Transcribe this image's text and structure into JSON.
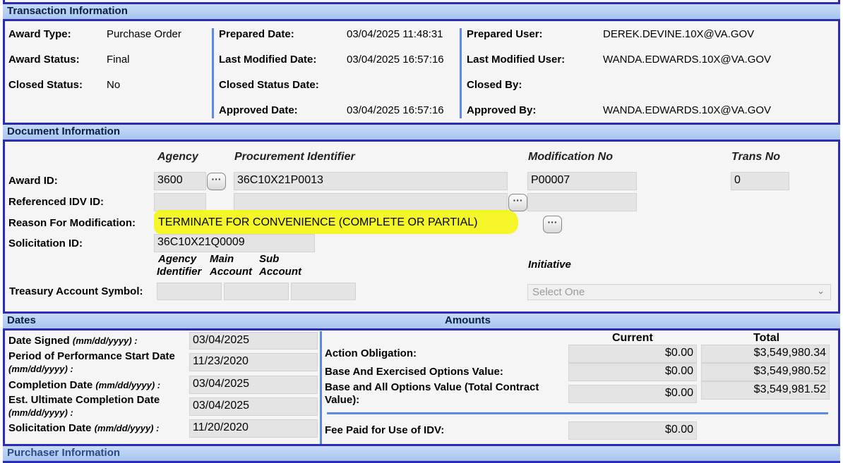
{
  "transaction": {
    "title": "Transaction Information",
    "award_type_label": "Award Type:",
    "award_type": "Purchase Order",
    "award_status_label": "Award Status:",
    "award_status": "Final",
    "closed_status_label": "Closed Status:",
    "closed_status": "No",
    "prepared_date_label": "Prepared Date:",
    "prepared_date": "03/04/2025 11:48:31",
    "last_modified_date_label": "Last Modified Date:",
    "last_modified_date": "03/04/2025 16:57:16",
    "closed_status_date_label": "Closed Status Date:",
    "approved_date_label": "Approved Date:",
    "approved_date": "03/04/2025 16:57:16",
    "prepared_user_label": "Prepared User:",
    "prepared_user": "DEREK.DEVINE.10X@VA.GOV",
    "last_modified_user_label": "Last Modified User:",
    "last_modified_user": "WANDA.EDWARDS.10X@VA.GOV",
    "closed_by_label": "Closed By:",
    "approved_by_label": "Approved By:",
    "approved_by": "WANDA.EDWARDS.10X@VA.GOV"
  },
  "document": {
    "title": "Document Information",
    "col_agency": "Agency",
    "col_procurement": "Procurement Identifier",
    "col_modification": "Modification No",
    "col_trans": "Trans No",
    "award_id_label": "Award ID:",
    "award_agency": "3600",
    "award_procurement": "36C10X21P0013",
    "award_modification": "P00007",
    "award_trans": "0",
    "ref_idv_label": "Referenced IDV ID:",
    "reason_label": "Reason For Modification:",
    "reason_value": "TERMINATE FOR CONVENIENCE (COMPLETE OR PARTIAL)",
    "solicitation_label": "Solicitation ID:",
    "solicitation_value": "36C10X21Q0009",
    "tas_col_agency_1": "Agency",
    "tas_col_agency_2": "Identifier",
    "tas_col_main_1": "Main",
    "tas_col_main_2": "Account",
    "tas_col_sub_1": "Sub",
    "tas_col_sub_2": "Account",
    "initiative_label": "Initiative",
    "tas_label": "Treasury Account Symbol:",
    "initiative_placeholder": "Select One",
    "ellipsis": "···"
  },
  "dates": {
    "title": "Dates",
    "date_signed_label": "Date Signed",
    "date_signed_fmt": "(mm/dd/yyyy) :",
    "date_signed": "03/04/2025",
    "pop_start_label": "Period of Performance Start Date",
    "pop_start_fmt": "(mm/dd/yyyy) :",
    "pop_start": "11/23/2020",
    "completion_label": "Completion Date",
    "completion_fmt": "(mm/dd/yyyy) :",
    "completion": "03/04/2025",
    "est_completion_label": "Est. Ultimate Completion Date",
    "est_completion_fmt": "(mm/dd/yyyy) :",
    "est_completion": "03/04/2025",
    "solicitation_date_label": "Solicitation Date",
    "solicitation_date_fmt": "(mm/dd/yyyy) :",
    "solicitation_date": "11/20/2020"
  },
  "amounts": {
    "title": "Amounts",
    "col_current": "Current",
    "col_total": "Total",
    "action_obligation_label": "Action Obligation:",
    "action_obligation_current": "$0.00",
    "action_obligation_total": "$3,549,980.34",
    "base_exercised_label": "Base And Exercised Options Value:",
    "base_exercised_current": "$0.00",
    "base_exercised_total": "$3,549,980.52",
    "base_all_label_1": "Base and All Options Value (Total Contract",
    "base_all_label_2": "Value):",
    "base_all_current": "$0.00",
    "base_all_total": "$3,549,981.52",
    "fee_label": "Fee Paid for Use of IDV:",
    "fee_current": "$0.00"
  },
  "purchaser": {
    "title": "Purchaser Information"
  },
  "colors": {
    "bar_border": "#2b2bb8",
    "bar_fill": "#b9d1f3",
    "highlight": "#f3f51c",
    "field": "#e4e4e4"
  }
}
